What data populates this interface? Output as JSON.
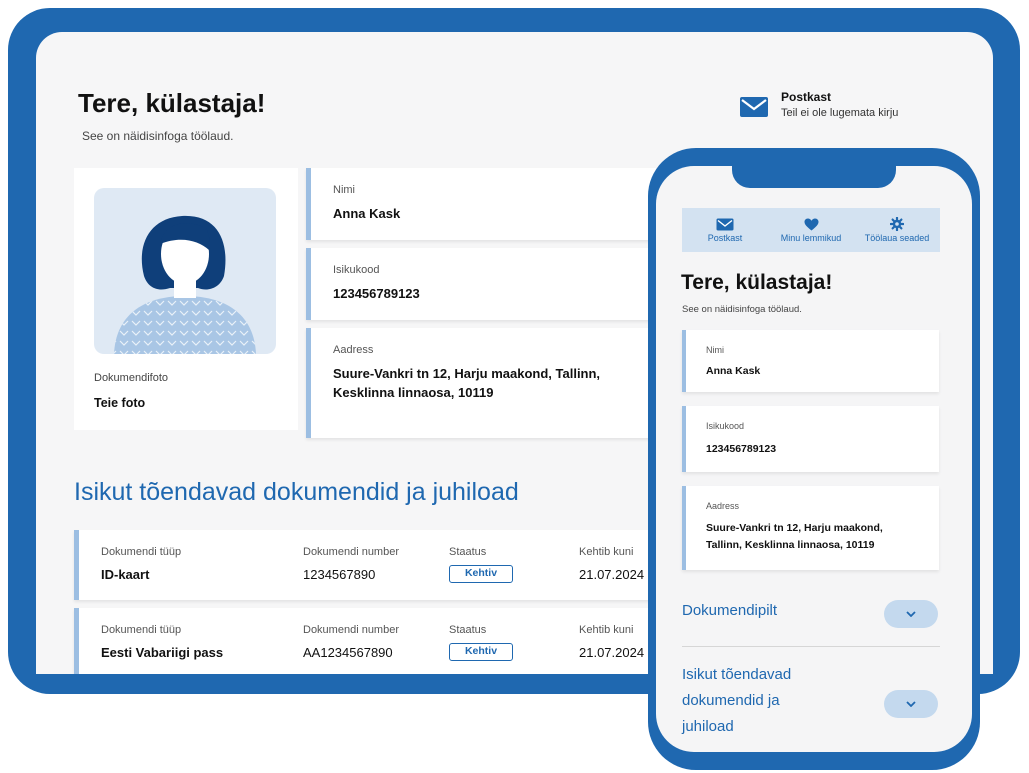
{
  "desktop": {
    "greeting": "Tere, külastaja!",
    "subtitle": "See on näidisinfoga töölaud.",
    "inbox": {
      "icon": "mail-icon",
      "title": "Postkast",
      "subtitle": "Teil ei ole lugemata kirju"
    },
    "photo": {
      "icon": "avatar-icon",
      "label": "Dokumendifoto",
      "value": "Teie foto"
    },
    "name": {
      "label": "Nimi",
      "value": "Anna Kask"
    },
    "idcode": {
      "label": "Isikukood",
      "value": "123456789123"
    },
    "address": {
      "label": "Aadress",
      "line1": "Suure-Vankri tn 12, Harju maakond, Tallinn,",
      "line2": "Kesklinna linnaosa, 10119"
    },
    "documents_title": "Isikut tõendavad dokumendid ja juhiload",
    "columns": {
      "type": "Dokumendi tüüp",
      "number": "Dokumendi number",
      "status": "Staatus",
      "valid": "Kehtib kuni"
    },
    "documents": [
      {
        "type": "ID-kaart",
        "number": "1234567890",
        "status": "Kehtiv",
        "valid": "21.07.2024"
      },
      {
        "type": "Eesti Vabariigi pass",
        "number": "AA1234567890",
        "status": "Kehtiv",
        "valid": "21.07.2024"
      }
    ]
  },
  "mobile": {
    "nav": [
      {
        "icon": "mail-icon",
        "label": "Postkast"
      },
      {
        "icon": "heart-icon",
        "label": "Minu lemmikud"
      },
      {
        "icon": "gear-icon",
        "label": "Töölaua seaded"
      }
    ],
    "greeting": "Tere, külastaja!",
    "subtitle": "See on näidisinfoga töölaud.",
    "name": {
      "label": "Nimi",
      "value": "Anna Kask"
    },
    "idcode": {
      "label": "Isikukood",
      "value": "123456789123"
    },
    "address": {
      "label": "Aadress",
      "line1": "Suure-Vankri tn 12, Harju maakond,",
      "line2": "Tallinn, Kesklinna linnaosa, 10119"
    },
    "accordion_photo": "Dokumendipilt",
    "accordion_docs": {
      "line1": "Isikut tõendavad",
      "line2": "dokumendid ja",
      "line3": "juhiload"
    }
  },
  "colors": {
    "brand": "#1f68b0",
    "accent_light": "#9cbee2",
    "photo_bg": "#dfe9f4",
    "nav_bg": "#d3e2f1"
  }
}
